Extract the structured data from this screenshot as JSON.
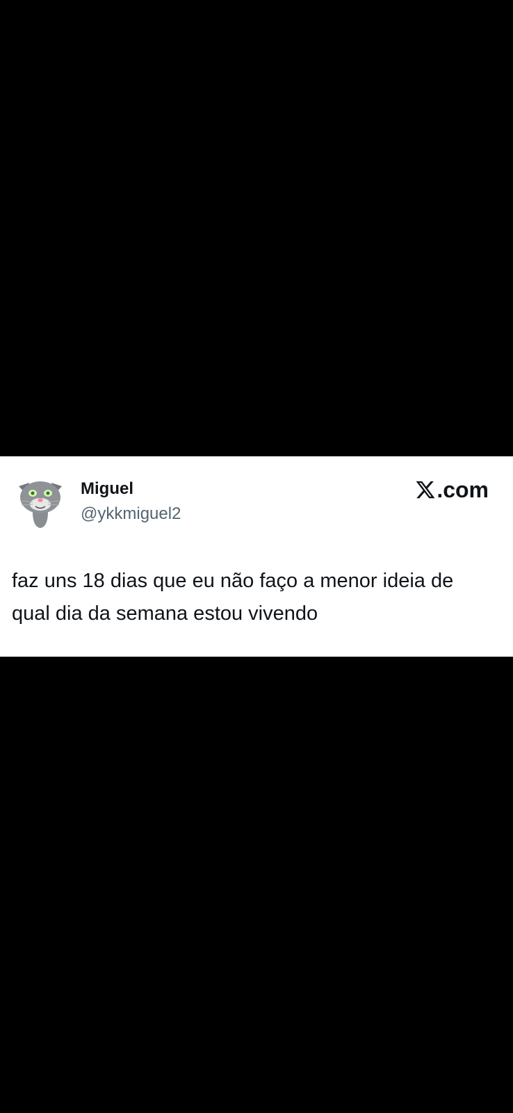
{
  "tweet": {
    "author": {
      "display_name": "Miguel",
      "handle": "@ykkmiguel2",
      "avatar_icon": "cat-avatar-icon"
    },
    "brand": {
      "logo_icon": "x-logo-icon",
      "suffix": ".com"
    },
    "text_lines": [
      "faz uns 18 dias que eu não faço a menor ideia de",
      "qual dia da semana estou vivendo"
    ]
  },
  "colors": {
    "background": "#000000",
    "card": "#ffffff",
    "primary_text": "#0f1419",
    "secondary_text": "#536471"
  }
}
